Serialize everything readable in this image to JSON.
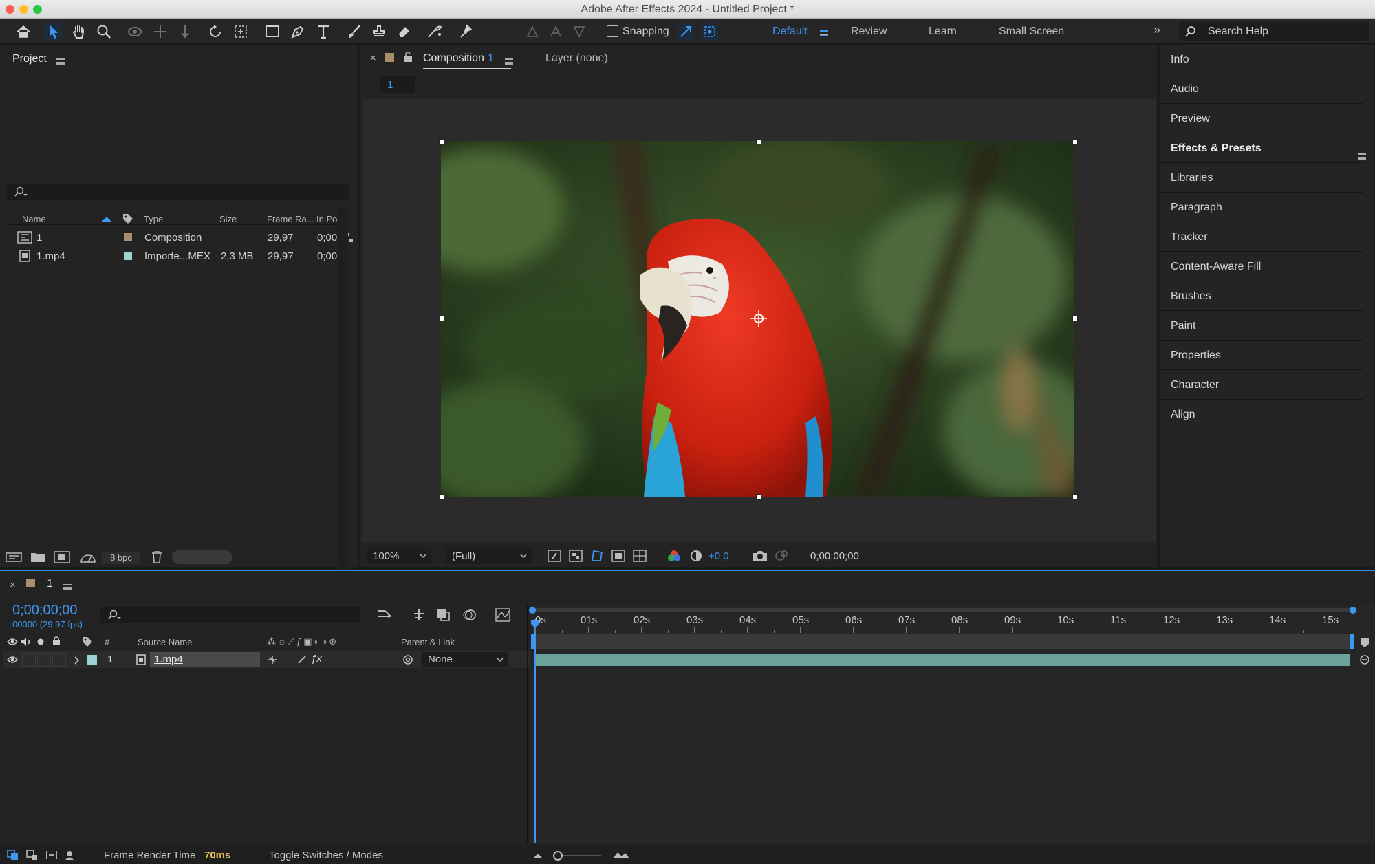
{
  "window": {
    "title": "Adobe After Effects 2024 - Untitled Project *"
  },
  "toolbar": {
    "snapping_label": "Snapping",
    "workspaces": [
      "Default",
      "Review",
      "Learn",
      "Small Screen"
    ],
    "search_placeholder": "Search Help"
  },
  "project": {
    "title": "Project",
    "columns": {
      "name": "Name",
      "type": "Type",
      "size": "Size",
      "frame_rate": "Frame Ra...",
      "in_point": "In Point"
    },
    "items": [
      {
        "name": "1",
        "label_color": "#a88e6a",
        "type": "Composition",
        "size": "",
        "frame_rate": "29,97",
        "in_point": "0;00"
      },
      {
        "name": "1.mp4",
        "label_color": "#9ed2d4",
        "type": "Importe...MEX",
        "size": "2,3 MB",
        "frame_rate": "29,97",
        "in_point": "0;00"
      }
    ],
    "bpc": "8 bpc"
  },
  "viewer": {
    "tab_label": "Composition",
    "tab_comp": "1",
    "layer_tab": "Layer (none)",
    "breadcrumb": "1",
    "zoom": "100%",
    "resolution": "(Full)",
    "exposure": "+0,0",
    "timecode": "0;00;00;00"
  },
  "right_panels": [
    "Info",
    "Audio",
    "Preview",
    "Effects & Presets",
    "Libraries",
    "Paragraph",
    "Tracker",
    "Content-Aware Fill",
    "Brushes",
    "Paint",
    "Properties",
    "Character",
    "Align"
  ],
  "timeline": {
    "tab_label": "1",
    "timecode": "0;00;00;00",
    "frames": "00000 (29.97 fps)",
    "col_num": "#",
    "col_source": "Source Name",
    "col_parent": "Parent & Link",
    "ruler": [
      "0s",
      "01s",
      "02s",
      "03s",
      "04s",
      "05s",
      "06s",
      "07s",
      "08s",
      "09s",
      "10s",
      "11s",
      "12s",
      "13s",
      "14s",
      "15s"
    ],
    "layer": {
      "index": "1",
      "name": "1.mp4",
      "parent": "None",
      "label_color": "#9ed2d4"
    }
  },
  "status": {
    "render_label": "Frame Render Time",
    "render_value": "70ms",
    "toggle_label": "Toggle Switches / Modes"
  },
  "colors": {
    "accent": "#2d8ceb",
    "panel": "#232323",
    "layer_bar": "#6ba39c"
  }
}
